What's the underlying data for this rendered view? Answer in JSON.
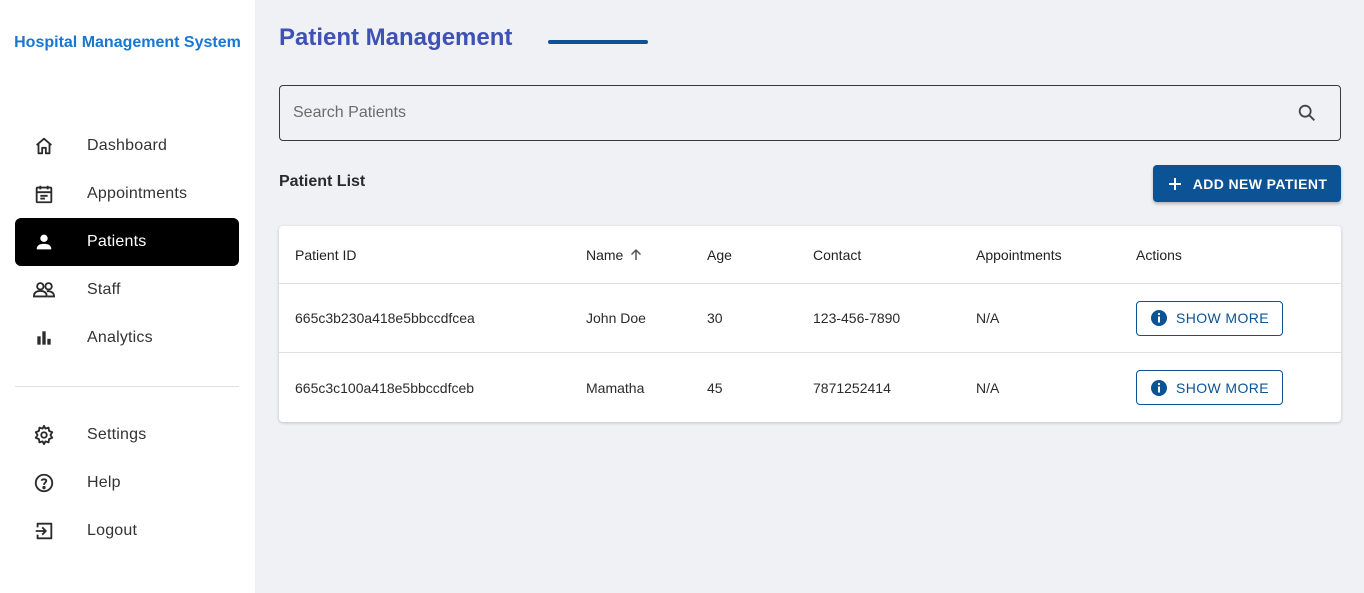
{
  "app": {
    "brand": "Hospital Management System"
  },
  "sidebar": {
    "primary": [
      {
        "label": "Dashboard",
        "icon": "home-icon",
        "active": false
      },
      {
        "label": "Appointments",
        "icon": "calendar-icon",
        "active": false
      },
      {
        "label": "Patients",
        "icon": "person-icon",
        "active": true
      },
      {
        "label": "Staff",
        "icon": "people-icon",
        "active": false
      },
      {
        "label": "Analytics",
        "icon": "bar-chart-icon",
        "active": false
      }
    ],
    "secondary": [
      {
        "label": "Settings",
        "icon": "gear-icon"
      },
      {
        "label": "Help",
        "icon": "help-icon"
      },
      {
        "label": "Logout",
        "icon": "logout-icon"
      }
    ]
  },
  "main": {
    "title": "Patient Management",
    "search": {
      "placeholder": "Search Patients",
      "value": ""
    },
    "list_heading": "Patient List",
    "add_button": "ADD NEW PATIENT",
    "table": {
      "columns": [
        "Patient ID",
        "Name",
        "Age",
        "Contact",
        "Appointments",
        "Actions"
      ],
      "sorted_column": "Name",
      "sort_direction": "ascending",
      "rows": [
        {
          "id": "665c3b230a418e5bbccdfcea",
          "name": "John Doe",
          "age": "30",
          "contact": "123-456-7890",
          "appointments": "N/A",
          "action": "SHOW MORE"
        },
        {
          "id": "665c3c100a418e5bbccdfceb",
          "name": "Mamatha",
          "age": "45",
          "contact": "7871252414",
          "appointments": "N/A",
          "action": "SHOW MORE"
        }
      ]
    }
  },
  "colors": {
    "brand": "#1976d2",
    "title": "#3f51b5",
    "primary": "#0b5394",
    "active_nav": "#000000",
    "background": "#f0f1f5"
  }
}
